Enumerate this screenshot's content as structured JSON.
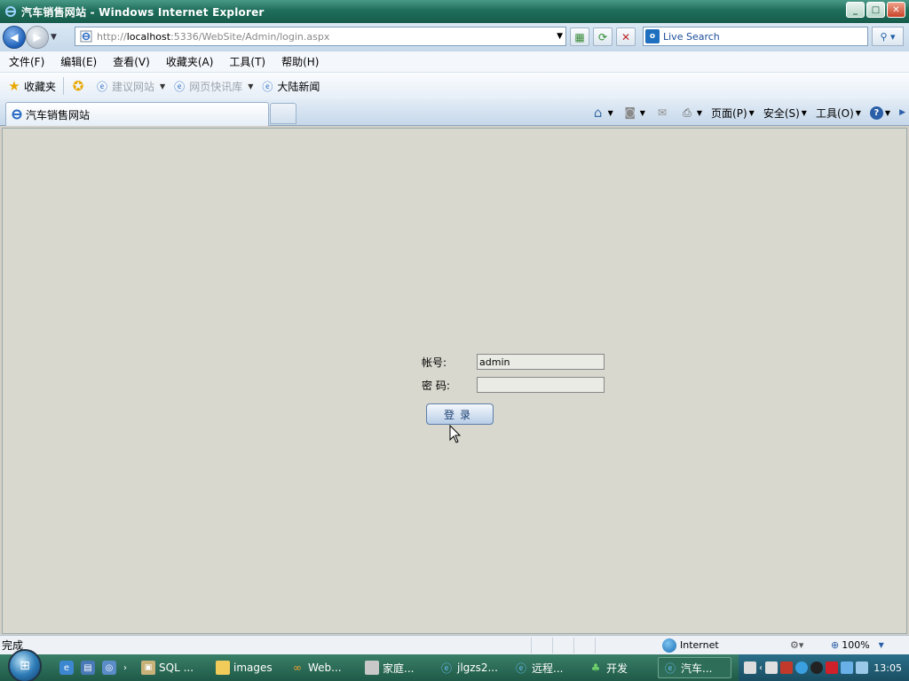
{
  "window": {
    "title": "汽车销售网站 - Windows Internet Explorer",
    "controls": {
      "minimize": "_",
      "restore": "□",
      "close": "✕"
    }
  },
  "address_bar": {
    "url_prefix": "http://",
    "url_host": "localhost",
    "url_rest": ":5336/WebSite/Admin/login.aspx"
  },
  "search": {
    "placeholder": "Live Search",
    "icon_letter": "o"
  },
  "menu": [
    "文件(F)",
    "编辑(E)",
    "查看(V)",
    "收藏夹(A)",
    "工具(T)",
    "帮助(H)"
  ],
  "favorites": {
    "label": "收藏夹",
    "items": [
      {
        "label": "建议网站",
        "dim": true
      },
      {
        "label": "网页快讯库",
        "dim": true
      },
      {
        "label": "大陆新闻",
        "dim": false
      }
    ]
  },
  "tab": {
    "label": "汽车销售网站"
  },
  "command_bar": {
    "page": "页面(P)",
    "safety": "安全(S)",
    "tools": "工具(O)"
  },
  "login_form": {
    "account_label": "帐号:",
    "account_value": "admin",
    "password_label": "密 码:",
    "password_value": "",
    "submit_label": "登录"
  },
  "status_bar": {
    "text": "完成",
    "zone": "Internet",
    "zoom": "100%"
  },
  "taskbar": {
    "tasks": [
      {
        "label": "SQL ..."
      },
      {
        "label": "images"
      },
      {
        "label": "Web..."
      },
      {
        "label": "家庭..."
      },
      {
        "label": "jlgzs2..."
      },
      {
        "label": "远程..."
      },
      {
        "label": "开发"
      },
      {
        "label": "汽车..."
      }
    ],
    "clock": "13:05"
  },
  "colors": {
    "titlebar": "#1f6e5b",
    "content_bg": "#d8d8ce",
    "taskbar": "#2a6b56"
  }
}
